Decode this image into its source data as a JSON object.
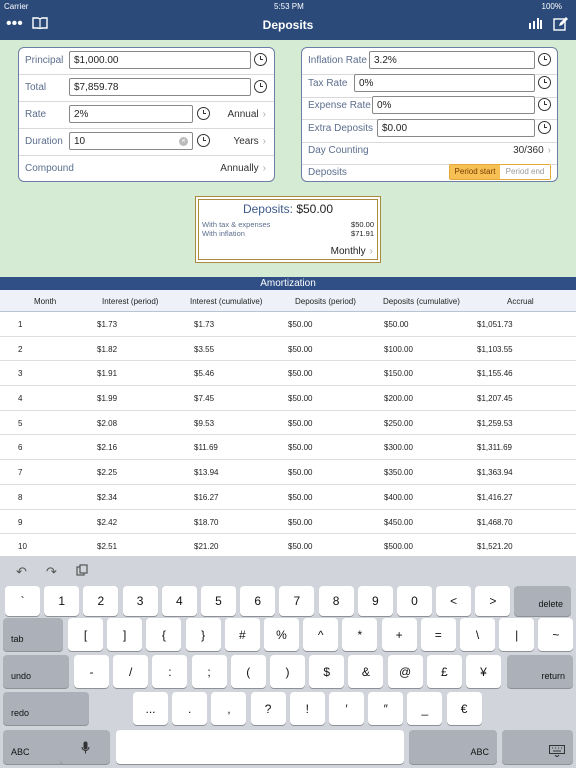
{
  "status": {
    "carrier": "Carrier",
    "time": "5:53 PM",
    "battery": "100%"
  },
  "nav": {
    "title": "Deposits",
    "menu_icon": "ellipsis-icon",
    "book_icon": "book-icon",
    "chart_icon": "bar-chart-icon",
    "edit_icon": "compose-icon"
  },
  "left_panel": {
    "principal_label": "Principal",
    "principal_value": "$1,000.00",
    "total_label": "Total",
    "total_value": "$7,859.78",
    "rate_label": "Rate",
    "rate_value": "2%",
    "rate_period": "Annual",
    "duration_label": "Duration",
    "duration_value": "10",
    "duration_unit": "Years",
    "compound_label": "Compound",
    "compound_value": "Annually"
  },
  "right_panel": {
    "inflation_label": "Inflation Rate",
    "inflation_value": "3.2%",
    "tax_label": "Tax Rate",
    "tax_value": "0%",
    "expense_label": "Expense Rate",
    "expense_value": "0%",
    "extra_label": "Extra Deposits",
    "extra_value": "$0.00",
    "day_label": "Day Counting",
    "day_value": "30/360",
    "deposits_label": "Deposits",
    "period_start": "Period start",
    "period_end": "Period end"
  },
  "deposits_box": {
    "title": "Deposits:",
    "amount": "$50.00",
    "tax_label": "With tax & expenses",
    "tax_value": "$50.00",
    "inflation_label": "With inflation",
    "inflation_value": "$71.91",
    "frequency": "Monthly"
  },
  "table": {
    "title": "Amortization",
    "headers": [
      "Month",
      "Interest  (period)",
      "Interest  (cumulative)",
      "Deposits (period)",
      "Deposits (cumulative)",
      "Accrual"
    ],
    "rows": [
      [
        "1",
        "$1.73",
        "$1.73",
        "$50.00",
        "$50.00",
        "$1,051.73"
      ],
      [
        "2",
        "$1.82",
        "$3.55",
        "$50.00",
        "$100.00",
        "$1,103.55"
      ],
      [
        "3",
        "$1.91",
        "$5.46",
        "$50.00",
        "$150.00",
        "$1,155.46"
      ],
      [
        "4",
        "$1.99",
        "$7.45",
        "$50.00",
        "$200.00",
        "$1,207.45"
      ],
      [
        "5",
        "$2.08",
        "$9.53",
        "$50.00",
        "$250.00",
        "$1,259.53"
      ],
      [
        "6",
        "$2.16",
        "$11.69",
        "$50.00",
        "$300.00",
        "$1,311.69"
      ],
      [
        "7",
        "$2.25",
        "$13.94",
        "$50.00",
        "$350.00",
        "$1,363.94"
      ],
      [
        "8",
        "$2.34",
        "$16.27",
        "$50.00",
        "$400.00",
        "$1,416.27"
      ],
      [
        "9",
        "$2.42",
        "$18.70",
        "$50.00",
        "$450.00",
        "$1,468.70"
      ],
      [
        "10",
        "$2.51",
        "$21.20",
        "$50.00",
        "$500.00",
        "$1,521.20"
      ]
    ]
  },
  "keyboard": {
    "tool_icons": [
      "undo-icon",
      "redo-icon",
      "paste-icon"
    ],
    "row1": [
      "`",
      "1",
      "2",
      "3",
      "4",
      "5",
      "6",
      "7",
      "8",
      "9",
      "0",
      "<",
      ">"
    ],
    "delete": "delete",
    "tab": "tab",
    "row2": [
      "[",
      "]",
      "{",
      "}",
      "#",
      "%",
      "^",
      "*",
      "+",
      "=",
      "\\",
      "|",
      "~"
    ],
    "undo": "undo",
    "row3": [
      "-",
      "/",
      ":",
      ";",
      "(",
      ")",
      "$",
      "&",
      "@",
      "£",
      "¥"
    ],
    "return": "return",
    "redo": "redo",
    "row4": [
      "...",
      ".",
      ",",
      "?",
      "!",
      "′",
      "″",
      "_",
      "€"
    ],
    "abc": "ABC",
    "mic_icon": "microphone-icon",
    "hide_icon": "keyboard-hide-icon"
  }
}
